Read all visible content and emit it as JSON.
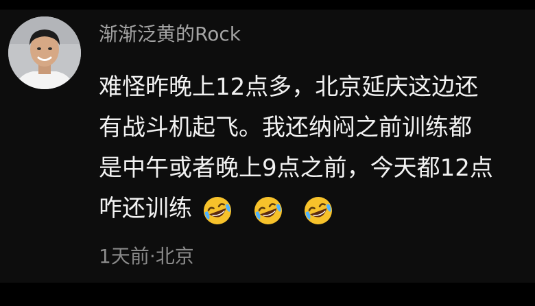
{
  "comment": {
    "username": "渐渐泛黄的Rock",
    "lines": [
      "难怪昨晚上12点多，北京延庆这边还",
      "有战斗机起飞。我还纳闷之前训练都",
      "是中午或者晚上9点之前，今天都12点",
      "咋还训练"
    ],
    "emojis": [
      "rolling-on-floor-laughing",
      "rolling-on-floor-laughing",
      "rolling-on-floor-laughing"
    ],
    "time": "1天前",
    "separator": "·",
    "location": "北京"
  },
  "colors": {
    "background": "#0d0d0d",
    "username": "#a4a4a4",
    "text": "#f2f2f2",
    "meta": "#8a8a8a",
    "emoji_face": "#f7c22b"
  }
}
